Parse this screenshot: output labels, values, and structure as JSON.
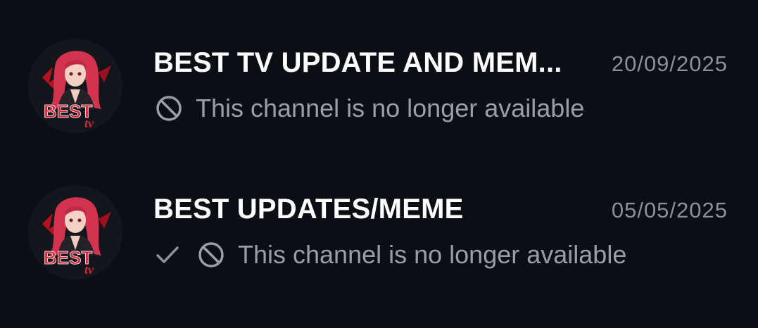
{
  "chats": [
    {
      "title": "BEST TV UPDATE AND MEM...",
      "date": "20/09/2025",
      "preview": "This channel is no longer available",
      "avatar": {
        "icon": "anime-girl-logo-icon",
        "logo_text": "BEST tv"
      },
      "read_check": false
    },
    {
      "title": "BEST UPDATES/MEME",
      "date": "05/05/2025",
      "preview": "This channel is no longer available",
      "avatar": {
        "icon": "anime-girl-logo-icon",
        "logo_text": "BEST tv"
      },
      "read_check": true
    }
  ],
  "colors": {
    "background": "#0b0e13",
    "title": "#ffffff",
    "meta": "#8c9098",
    "preview": "#9a9ea6",
    "logo_red": "#d8253a"
  }
}
